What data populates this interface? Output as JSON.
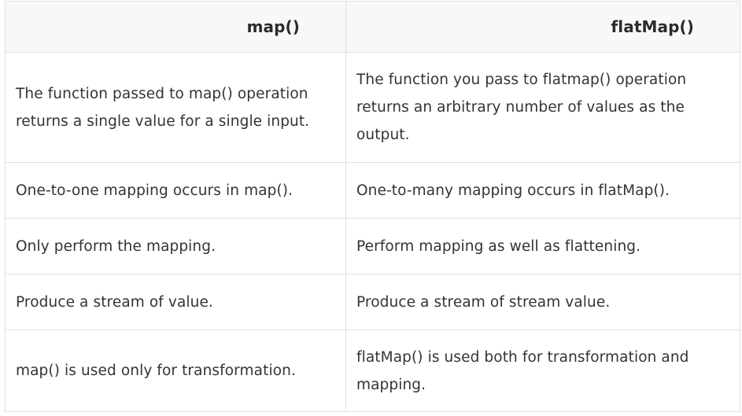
{
  "table": {
    "headers": [
      "map()",
      "flatMap()"
    ],
    "rows": [
      [
        "The function passed to map() operation returns a single value for a single input.",
        "The function you pass to flatmap() operation returns an arbitrary number of values as the output."
      ],
      [
        "One-to-one mapping occurs in map().",
        "One-to-many mapping occurs in flatMap()."
      ],
      [
        "Only perform the mapping.",
        "Perform mapping as well as flattening."
      ],
      [
        "Produce a stream of value.",
        "Produce a stream of stream value."
      ],
      [
        "map() is used only for transformation.",
        "flatMap() is used both for transformation and mapping."
      ]
    ]
  }
}
